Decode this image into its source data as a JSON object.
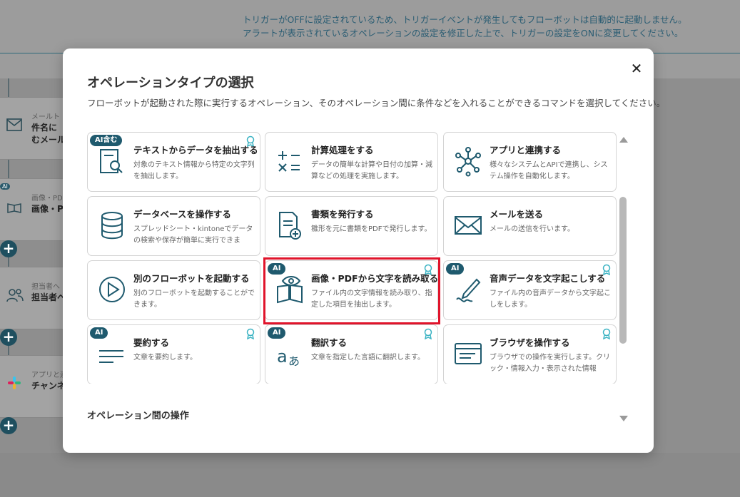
{
  "notice": {
    "line1": "トリガーがOFFに設定されているため、トリガーイベントが発生してもフローボットは自動的に起動しません。",
    "line2": "アラートが表示されているオペレーションの設定を修正した上で、トリガーの設定をONに変更してください。"
  },
  "background_cards": [
    {
      "sub": "メールト",
      "title": "件名に\nむメール",
      "icon": "mail-icon"
    },
    {
      "sub": "画像・PDF",
      "title": "画像・Pl",
      "icon": "book-eye-icon",
      "ai": "AI"
    },
    {
      "sub": "担当者へ",
      "title": "担当者へ",
      "icon": "people-icon"
    },
    {
      "sub": "アプリと連",
      "title": "チャンネ",
      "icon": "slack-icon"
    }
  ],
  "modal": {
    "title": "オペレーションタイプの選択",
    "description": "フローボットが起動された際に実行するオペレーション、そのオペレーション間に条件などを入れることができるコマンドを選択してください。",
    "close_label": "✕",
    "cards": [
      {
        "title": "テキストからデータを抽出する",
        "desc": "対象のテキスト情報から特定の文字列を抽出します。",
        "icon": "document-search-icon",
        "badge": "AI含む",
        "ribbon": true
      },
      {
        "title": "計算処理をする",
        "desc": "データの簡単な計算や日付の加算・減算などの処理を実施します。",
        "icon": "calculator-icon",
        "badge": "",
        "ribbon": false
      },
      {
        "title": "アプリと連携する",
        "desc": "様々なシステムとAPIで連携し、システム操作を自動化します。",
        "icon": "network-icon",
        "badge": "",
        "ribbon": false
      },
      {
        "title": "データベースを操作する",
        "desc": "スプレッドシート・kintoneでデータの検索や保存が簡単に実行できま",
        "icon": "database-icon",
        "badge": "",
        "ribbon": false
      },
      {
        "title": "書類を発行する",
        "desc": "雛形を元に書類をPDFで発行します。",
        "icon": "document-add-icon",
        "badge": "",
        "ribbon": false
      },
      {
        "title": "メールを送る",
        "desc": "メールの送信を行います。",
        "icon": "envelope-icon",
        "badge": "",
        "ribbon": false
      },
      {
        "title": "別のフローボットを起動する",
        "desc": "別のフローボットを起動することができます。",
        "icon": "play-circle-icon",
        "badge": "",
        "ribbon": false
      },
      {
        "title": "画像・PDFから文字を読み取る",
        "desc": "ファイル内の文字情報を読み取り、指定した項目を抽出します。",
        "icon": "book-eye-icon",
        "badge": "AI",
        "ribbon": true
      },
      {
        "title": "音声データを文字起こしする",
        "desc": "ファイル内の音声データから文字起こしをします。",
        "icon": "pen-wave-icon",
        "badge": "AI",
        "ribbon": true
      },
      {
        "title": "要約する",
        "desc": "文章を要約します。",
        "icon": "lines-icon",
        "badge": "AI",
        "ribbon": true
      },
      {
        "title": "翻訳する",
        "desc": "文章を指定した言語に翻訳します。",
        "icon": "translate-icon",
        "badge": "AI",
        "ribbon": true
      },
      {
        "title": "ブラウザを操作する",
        "desc": "ブラウザでの操作を実行します。クリック・情報入力・表示された情報",
        "icon": "browser-icon",
        "badge": "",
        "ribbon": true
      }
    ],
    "section_title": "オペレーション間の操作"
  },
  "colors": {
    "accent": "#1f5a6e",
    "highlight": "#e0142b",
    "icon": "#1f5a6e"
  }
}
